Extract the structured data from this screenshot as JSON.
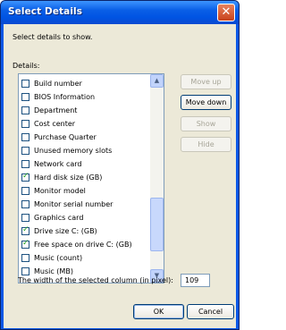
{
  "window": {
    "title": "Select Details",
    "close_symbol": "✕"
  },
  "instruction": "Select details to show.",
  "details_label": "Details:",
  "items": [
    {
      "label": "Build number",
      "checked": false
    },
    {
      "label": "BIOS Information",
      "checked": false
    },
    {
      "label": "Department",
      "checked": false
    },
    {
      "label": "Cost center",
      "checked": false
    },
    {
      "label": "Purchase Quarter",
      "checked": false
    },
    {
      "label": "Unused memory slots",
      "checked": false
    },
    {
      "label": "Network card",
      "checked": false
    },
    {
      "label": "Hard disk size (GB)",
      "checked": true
    },
    {
      "label": "Monitor model",
      "checked": false
    },
    {
      "label": "Monitor serial number",
      "checked": false
    },
    {
      "label": "Graphics card",
      "checked": false
    },
    {
      "label": "Drive size C: (GB)",
      "checked": true
    },
    {
      "label": "Free space on drive C: (GB)",
      "checked": true
    },
    {
      "label": "Music (count)",
      "checked": false
    },
    {
      "label": "Music (MB)",
      "checked": false
    }
  ],
  "buttons": {
    "move_up": "Move up",
    "move_down": "Move down",
    "show": "Show",
    "hide": "Hide",
    "ok": "OK",
    "cancel": "Cancel"
  },
  "width_label": "The width of the selected column (in pixel):",
  "width_value": "109"
}
